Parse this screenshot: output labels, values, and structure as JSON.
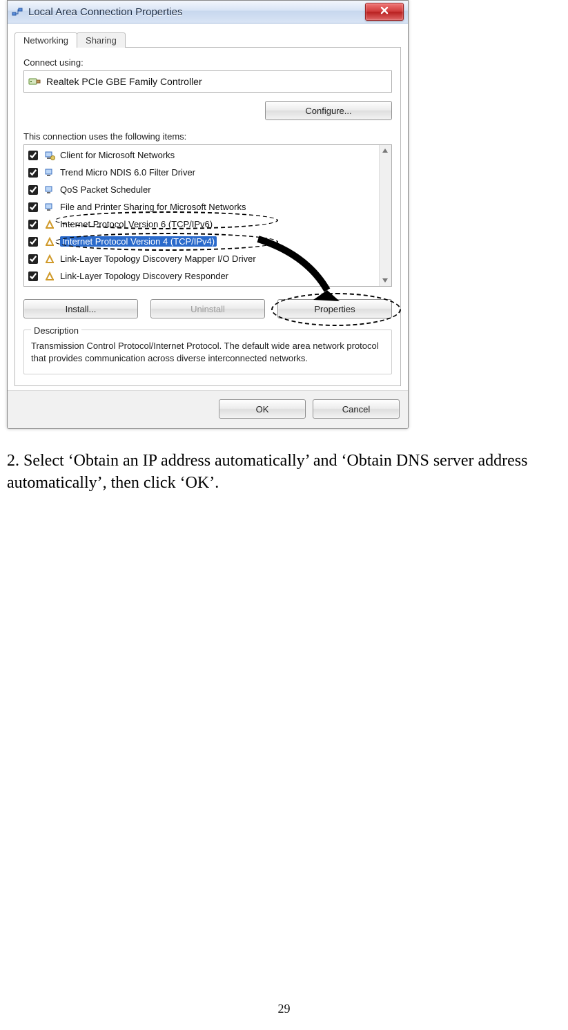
{
  "window": {
    "title": "Local Area Connection Properties",
    "close_tooltip": "Close"
  },
  "tabs": {
    "networking": "Networking",
    "sharing": "Sharing"
  },
  "connect_using_label": "Connect using:",
  "adapter_name": "Realtek PCIe GBE Family Controller",
  "configure_label": "Configure...",
  "items_label": "This connection uses the following items:",
  "items": [
    {
      "label": "Client for Microsoft Networks"
    },
    {
      "label": "Trend Micro NDIS 6.0 Filter Driver"
    },
    {
      "label": "QoS Packet Scheduler"
    },
    {
      "label": "File and Printer Sharing for Microsoft Networks"
    },
    {
      "label": "Internet Protocol Version 6 (TCP/IPv6)"
    },
    {
      "label": "Internet Protocol Version 4 (TCP/IPv4)"
    },
    {
      "label": "Link-Layer Topology Discovery Mapper I/O Driver"
    },
    {
      "label": "Link-Layer Topology Discovery Responder"
    }
  ],
  "buttons": {
    "install": "Install...",
    "uninstall": "Uninstall",
    "properties": "Properties",
    "ok": "OK",
    "cancel": "Cancel"
  },
  "description": {
    "legend": "Description",
    "text": "Transmission Control Protocol/Internet Protocol. The default wide area network protocol that provides communication across diverse interconnected networks."
  },
  "instruction": "2. Select ‘Obtain an IP address automatically’ and ‘Obtain DNS server address automatically’, then click ‘OK’.",
  "page_number": "29"
}
